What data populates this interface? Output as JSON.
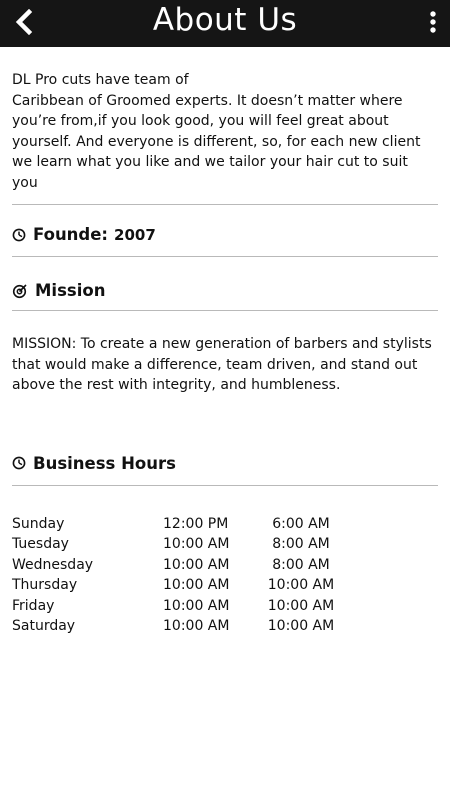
{
  "header": {
    "title": "About Us",
    "back_icon": "chevron-left-icon",
    "menu_icon": "more-vertical-icon"
  },
  "about": {
    "text_line1": "DL Pro cuts have team of",
    "text_rest": "Caribbean of Groomed experts. It doesn’t matter where you’re from,if you look good, you will feel great about yourself. And everyone is different, so, for each new client we learn what you like and we tailor your hair cut to suit you"
  },
  "founded": {
    "label": "Founde:",
    "year": "2007",
    "icon": "clock-icon"
  },
  "mission": {
    "heading": "Mission",
    "icon": "target-icon",
    "text": "MISSION: To create a new generation of barbers and stylists that would make a difference, team driven, and stand out above the rest with integrity, and humbleness."
  },
  "hours": {
    "heading": "Business Hours",
    "icon": "clock-icon",
    "rows": [
      {
        "day": "Sunday",
        "open": "12:00 PM",
        "close": "6:00 AM"
      },
      {
        "day": "Tuesday",
        "open": "10:00 AM",
        "close": "8:00 AM"
      },
      {
        "day": "Wednesday",
        "open": "10:00 AM",
        "close": "8:00 AM"
      },
      {
        "day": "Thursday",
        "open": "10:00 AM",
        "close": "10:00 AM"
      },
      {
        "day": "Friday",
        "open": "10:00 AM",
        "close": "10:00 AM"
      },
      {
        "day": "Saturday",
        "open": "10:00 AM",
        "close": "10:00 AM"
      }
    ]
  },
  "colors": {
    "header_bg": "#151515",
    "header_text": "#ffffff",
    "divider": "#b9b9b9",
    "body_text": "#111111"
  }
}
